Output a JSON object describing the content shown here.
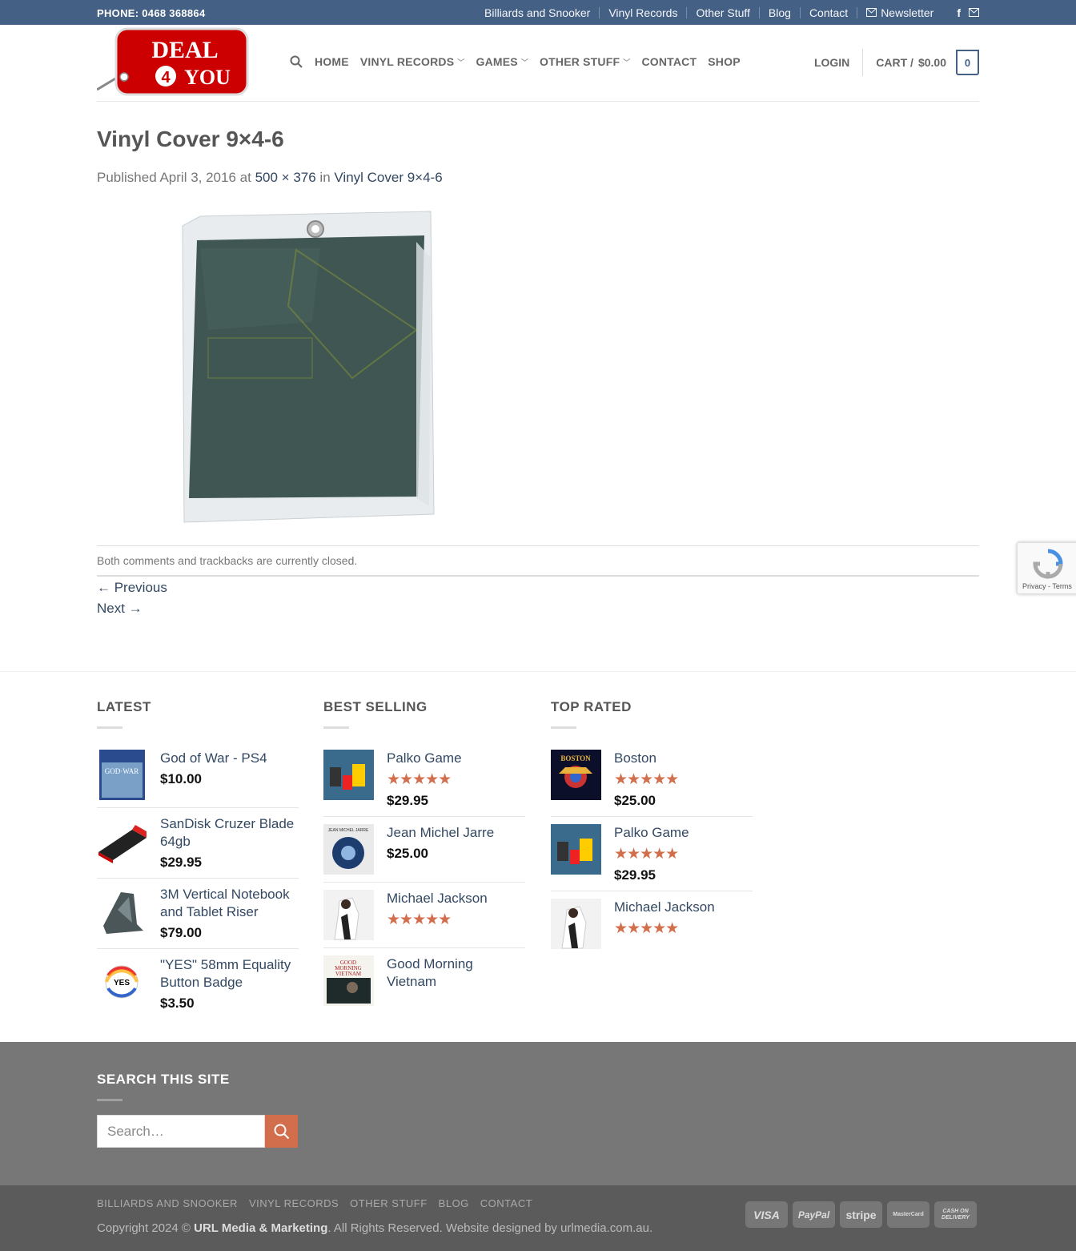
{
  "topbar": {
    "phone": "PHONE: 0468 368864",
    "links": [
      "Billiards and Snooker",
      "Vinyl Records",
      "Other Stuff",
      "Blog",
      "Contact"
    ],
    "newsletter": "Newsletter"
  },
  "logo": {
    "line1": "DEAL",
    "num": "4",
    "line2": "YOU"
  },
  "mainnav": {
    "home": "HOME",
    "vinyl": "VINYL RECORDS",
    "games": "GAMES",
    "other": "OTHER STUFF",
    "contact": "CONTACT",
    "shop": "SHOP"
  },
  "account": {
    "login": "LOGIN",
    "cart": "CART /",
    "amount": "$0.00",
    "count": "0"
  },
  "post": {
    "title": "Vinyl Cover 9×4-6",
    "published": "Published",
    "date": "April 3, 2016",
    "at": "at",
    "size": "500 × 376",
    "in": "in",
    "parent": "Vinyl Cover 9×4-6",
    "comments": "Both comments and trackbacks are currently closed.",
    "previous": "← Previous",
    "next": "Next →"
  },
  "recaptcha": {
    "terms": "Privacy - Terms"
  },
  "widgets": {
    "latest": {
      "title": "LATEST",
      "items": [
        {
          "name": "God of War - PS4",
          "price": "$10.00"
        },
        {
          "name": "SanDisk Cruzer Blade 64gb",
          "price": "$29.95"
        },
        {
          "name": "3M Vertical Notebook and Tablet Riser",
          "price": "$79.00"
        },
        {
          "name": "\"YES\" 58mm Equality Button Badge",
          "price": "$3.50"
        }
      ]
    },
    "best": {
      "title": "BEST SELLING",
      "items": [
        {
          "name": "Palko Game",
          "price": "$29.95",
          "rating": 5
        },
        {
          "name": "Jean Michel Jarre",
          "price": "$25.00"
        },
        {
          "name": "Michael Jackson",
          "price": "",
          "rating": 5
        },
        {
          "name": "Good Morning Vietnam",
          "price": ""
        }
      ]
    },
    "top": {
      "title": "TOP RATED",
      "items": [
        {
          "name": "Boston",
          "price": "$25.00",
          "rating": 5
        },
        {
          "name": "Palko Game",
          "price": "$29.95",
          "rating": 5
        },
        {
          "name": "Michael Jackson",
          "price": "",
          "rating": 5
        }
      ]
    }
  },
  "footer": {
    "search_title": "SEARCH THIS SITE",
    "search_placeholder": "Search…",
    "nav": [
      "BILLIARDS AND SNOOKER",
      "VINYL RECORDS",
      "OTHER STUFF",
      "BLOG",
      "CONTACT"
    ],
    "copy_pre": "Copyright 2024 ©",
    "copy_brand": "URL Media & Marketing",
    "copy_post": ". All Rights Reserved. Website designed by urlmedia.com.au.",
    "payments": [
      "VISA",
      "PayPal",
      "stripe",
      "MasterCard",
      "CASH ON DELIVERY"
    ]
  },
  "colors": {
    "primary": "#446084",
    "accent": "#d26e4b",
    "link": "#334862"
  }
}
